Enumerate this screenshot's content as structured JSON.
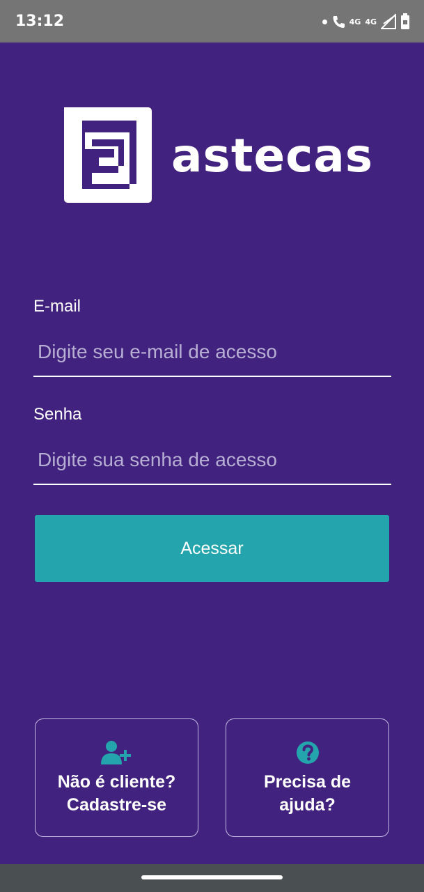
{
  "status_bar": {
    "time": "13:12",
    "network_1": "4G",
    "network_2": "4G",
    "icons": [
      "notification-dot-icon",
      "wifi-call-icon",
      "signal-icon",
      "battery-icon"
    ]
  },
  "brand": {
    "name": "astecas",
    "logo_icon": "astecas-logo-icon"
  },
  "form": {
    "email_label": "E-mail",
    "email_placeholder": "Digite seu e-mail de acesso",
    "email_value": "",
    "password_label": "Senha",
    "password_placeholder": "Digite sua senha de acesso",
    "password_value": "",
    "submit_label": "Acessar"
  },
  "cards": {
    "signup": {
      "line1": "Não é cliente?",
      "line2": "Cadastre-se",
      "icon": "user-plus-icon"
    },
    "help": {
      "line1": "Precisa de",
      "line2": "ajuda?",
      "icon": "question-circle-icon"
    }
  },
  "colors": {
    "background": "#42227f",
    "accent": "#24a4ac",
    "status_bar": "#757575",
    "nav_bar": "#4a4f52"
  }
}
